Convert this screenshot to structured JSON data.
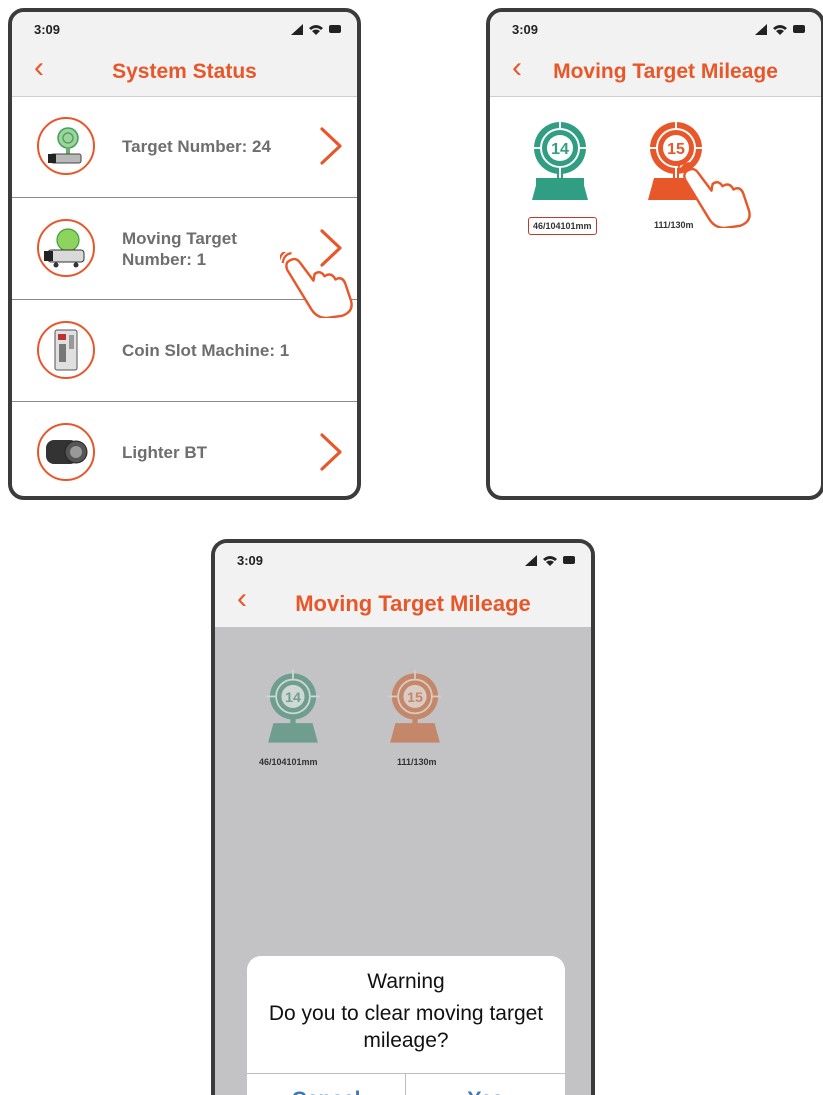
{
  "status_bar": {
    "time": "3:09",
    "icons": [
      "signal-icon",
      "wifi-icon",
      "battery-icon"
    ]
  },
  "screen1": {
    "back_icon": "chevron-left-icon",
    "title": "System Status",
    "rows": [
      {
        "label": "Target Number:  24",
        "icon": "standing-target-icon",
        "has_arrow": true
      },
      {
        "label_line1": "Moving Target",
        "label_line2": "Number: 1",
        "icon": "moving-target-device-icon",
        "has_arrow": true
      },
      {
        "label": "Coin Slot Machine: 1",
        "icon": "coin-slot-machine-icon",
        "has_arrow": false
      },
      {
        "label": "Lighter BT",
        "icon": "lighter-bt-icon",
        "has_arrow": true
      }
    ]
  },
  "screen2": {
    "back_icon": "chevron-left-icon",
    "title": "Moving Target Mileage",
    "targets": [
      {
        "number": "14",
        "mileage": "46/104101mm",
        "color": "#2f9e83"
      },
      {
        "number": "15",
        "mileage": "111/130m",
        "color": "#e8572a"
      }
    ]
  },
  "screen3": {
    "back_icon": "chevron-left-icon",
    "title": "Moving Target Mileage",
    "targets": [
      {
        "number": "14",
        "mileage": "46/104101mm",
        "color": "#6f9e8e"
      },
      {
        "number": "15",
        "mileage": "111/130m",
        "color": "#c48769"
      }
    ],
    "dialog": {
      "title": "Warning",
      "message": "Do you to clear moving target mileage?",
      "cancel": "Cancel",
      "confirm": "Yes"
    }
  },
  "colors": {
    "accent": "#e8572a",
    "teal": "#2f9e83",
    "link": "#3c78b8",
    "frame": "#3b3b3b",
    "overlay": "#c3c3c5"
  }
}
